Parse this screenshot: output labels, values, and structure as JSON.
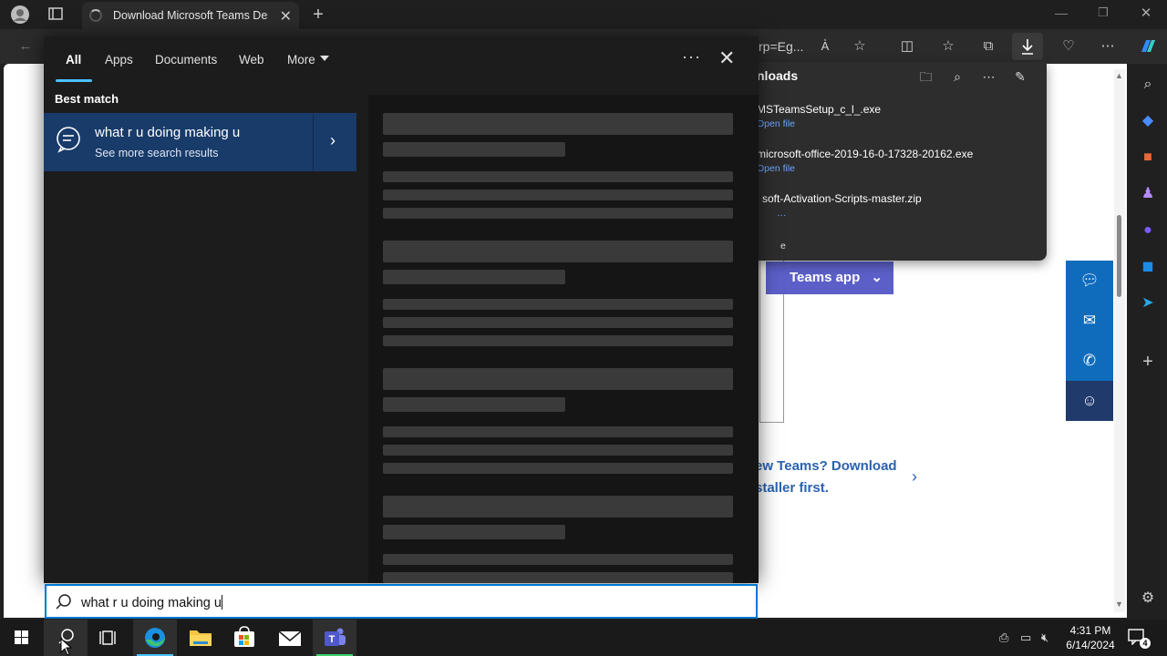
{
  "browser": {
    "tab_title": "Download Microsoft Teams Desk",
    "address_fragment": "rp=Eg...",
    "downloads": {
      "title": "nloads",
      "items": [
        {
          "name": "MSTeamsSetup_c_l_.exe",
          "action": "Open file"
        },
        {
          "name": "microsoft-office-2019-16-0-17328-20162.exe",
          "action": "Open file"
        },
        {
          "name": "soft-Activation-Scripts-master.zip",
          "action": "e"
        }
      ]
    }
  },
  "page": {
    "teams_button": "Teams app",
    "new_teams_line1": "ew Teams? Download",
    "new_teams_line2": "staller first."
  },
  "search": {
    "tabs": [
      "All",
      "Apps",
      "Documents",
      "Web",
      "More"
    ],
    "active_tab": "All",
    "best_match_label": "Best match",
    "best_match_title": "what r u doing making u",
    "best_match_subtitle": "See more search results",
    "query": "what r u doing making u"
  },
  "taskbar": {
    "time": "4:31 PM",
    "date": "6/14/2024",
    "notification_count": "4"
  },
  "colors": {
    "accent": "#0078d4",
    "best_match_bg": "#183b6a",
    "teams_purple": "#5b5fc7"
  }
}
